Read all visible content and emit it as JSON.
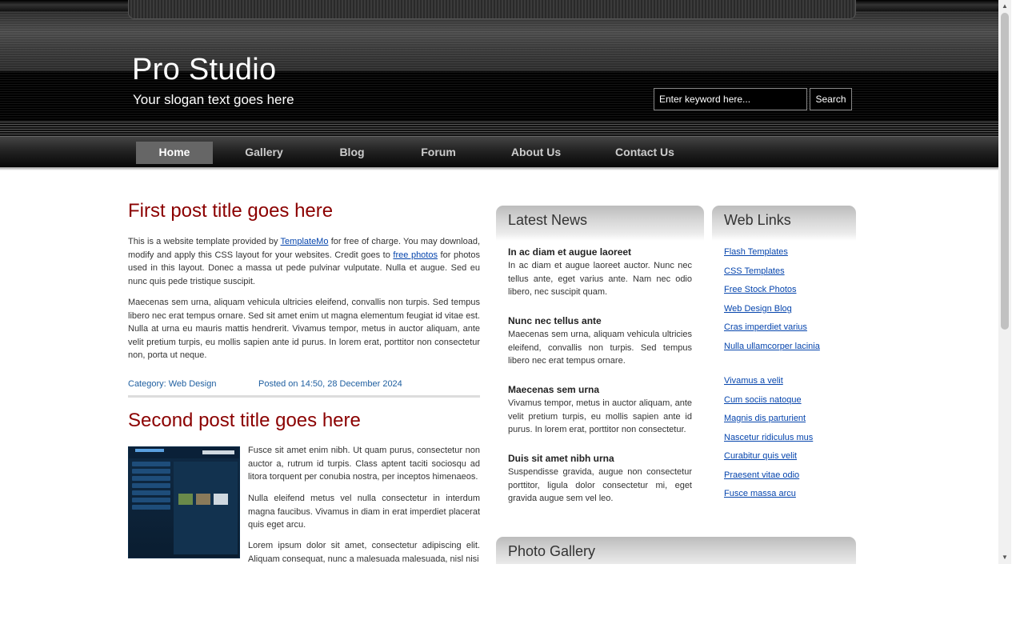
{
  "site": {
    "title": "Pro Studio",
    "slogan": "Your slogan text goes here",
    "search_placeholder": "Enter keyword here...",
    "search_button": "Search"
  },
  "menu": {
    "items": [
      {
        "label": "Home",
        "active": true
      },
      {
        "label": "Gallery",
        "active": false
      },
      {
        "label": "Blog",
        "active": false
      },
      {
        "label": "Forum",
        "active": false
      },
      {
        "label": "About Us",
        "active": false
      },
      {
        "label": "Contact Us",
        "active": false
      }
    ]
  },
  "posts": [
    {
      "title": "First post title goes here",
      "p1_a": "This is a website template provided by ",
      "p1_link1": "TemplateMo",
      "p1_b": " for free of charge. You may download, modify and apply this CSS layout for your websites. Credit goes to ",
      "p1_link2": "free photos",
      "p1_c": " for photos used in this layout. Donec a massa ut pede pulvinar vulputate. Nulla et augue. Sed eu nunc quis pede tristique suscipit.",
      "p2": "Maecenas sem urna, aliquam vehicula ultricies eleifend, convallis non turpis. Sed tempus libero nec erat tempus ornare. Sed sit amet enim ut magna elementum feugiat id vitae est. Nulla at urna eu mauris mattis hendrerit. Vivamus tempor, metus in auctor aliquam, ante velit pretium turpis, eu mollis sapien ante id purus. In lorem erat, porttitor non consectetur non, porta ut neque.",
      "category": "Category: Web Design",
      "posted": "Posted on 14:50, 28 December 2024"
    },
    {
      "title": "Second post title goes here",
      "p1": "Fusce sit amet enim nibh. Ut quam purus, consectetur non auctor a, rutrum id turpis. Class aptent taciti sociosqu ad litora torquent per conubia nostra, per inceptos himenaeos.",
      "p2": "Nulla eleifend metus vel nulla consectetur in interdum magna faucibus. Vivamus in diam in erat imperdiet placerat quis eget arcu.",
      "p3": "Lorem ipsum dolor sit amet, consectetur adipiscing elit. Aliquam consequat, nunc a malesuada malesuada, nisl nisi"
    }
  ],
  "news": {
    "title": "Latest News",
    "items": [
      {
        "heading": "In ac diam et augue laoreet",
        "text": "In ac diam et augue laoreet auctor. Nunc nec tellus ante, eget varius ante. Nam nec odio libero, nec suscipit quam."
      },
      {
        "heading": "Nunc nec tellus ante",
        "text": "Maecenas sem urna, aliquam vehicula ultricies eleifend, convallis non turpis. Sed tempus libero nec erat tempus ornare."
      },
      {
        "heading": "Maecenas sem urna",
        "text": "Vivamus tempor, metus in auctor aliquam, ante velit pretium turpis, eu mollis sapien ante id purus. In lorem erat, porttitor non consectetur."
      },
      {
        "heading": "Duis sit amet nibh urna",
        "text": "Suspendisse gravida, augue non consectetur porttitor, ligula dolor consectetur mi, eget gravida augue sem vel leo."
      }
    ]
  },
  "weblinks": {
    "title": "Web Links",
    "group1": [
      "Flash Templates",
      "CSS Templates",
      "Free Stock Photos",
      "Web Design Blog",
      "Cras imperdiet varius",
      "Nulla ullamcorper lacinia"
    ],
    "group2": [
      "Vivamus a velit",
      "Cum sociis natoque",
      "Magnis dis parturient",
      "Nascetur ridiculus mus",
      "Curabitur quis velit",
      "Praesent vitae odio",
      "Fusce massa arcu"
    ]
  },
  "gallery": {
    "title": "Photo Gallery"
  }
}
